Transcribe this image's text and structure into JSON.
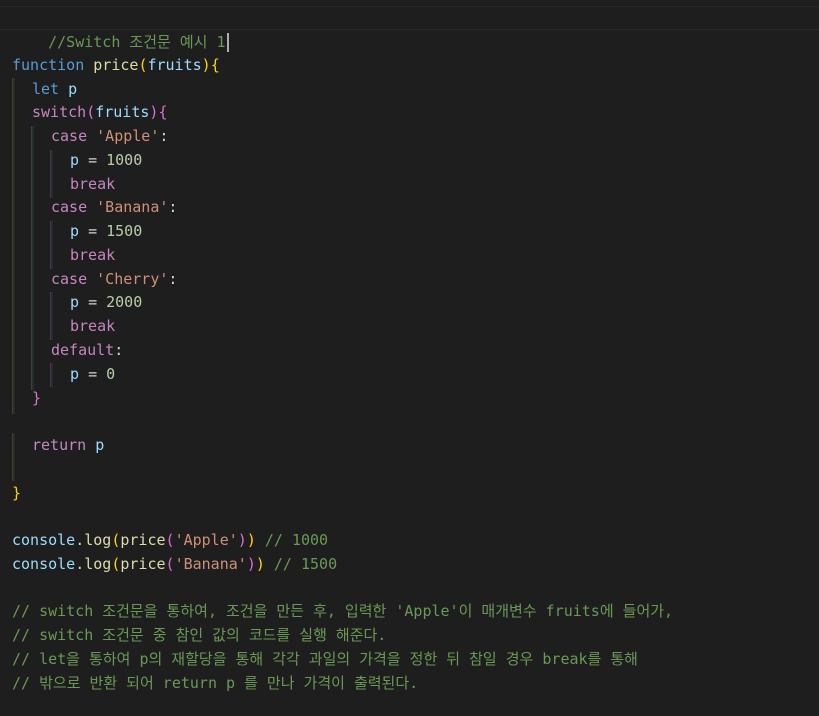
{
  "editor": {
    "header_comment": "//Switch 조건문 예시 1",
    "keywords": {
      "function": "function",
      "let": "let",
      "switch": "switch",
      "case": "case",
      "break": "break",
      "default": "default",
      "return": "return"
    },
    "identifiers": {
      "fn_name": "price",
      "param": "fruits",
      "var": "p",
      "console": "console",
      "log": "log"
    },
    "cases": [
      {
        "label": "'Apple'",
        "value": "1000"
      },
      {
        "label": "'Banana'",
        "value": "1500"
      },
      {
        "label": "'Cherry'",
        "value": "2000"
      }
    ],
    "default_value": "0",
    "console_calls": [
      {
        "arg": "'Apple'",
        "comment": "// 1000"
      },
      {
        "arg": "'Banana'",
        "comment": "// 1500"
      }
    ],
    "explanation_comments": [
      "// switch 조건문을 통하여, 조건을 만든 후, 입력한 'Apple'이 매개변수 fruits에 들어가,",
      "// switch 조건문 중 참인 값의 코드를 실행 해준다.",
      "// let을 통하여 p의 재할당을 통해 각각 과일의 가격을 정한 뒤 참일 경우 break를 통해",
      "// 밖으로 반환 되어 return p 를 만나 가격이 출력된다."
    ],
    "colors": {
      "background": "#1e1e1e",
      "comment": "#6a9955",
      "keyword": "#569cd6",
      "control": "#c586c0",
      "function": "#dcdcaa",
      "variable": "#9cdcfe",
      "string": "#ce9178",
      "number": "#b5cea8",
      "bracket_level1": "#ffd700",
      "bracket_level2": "#da70d6",
      "bracket_level3": "#179fff"
    }
  }
}
